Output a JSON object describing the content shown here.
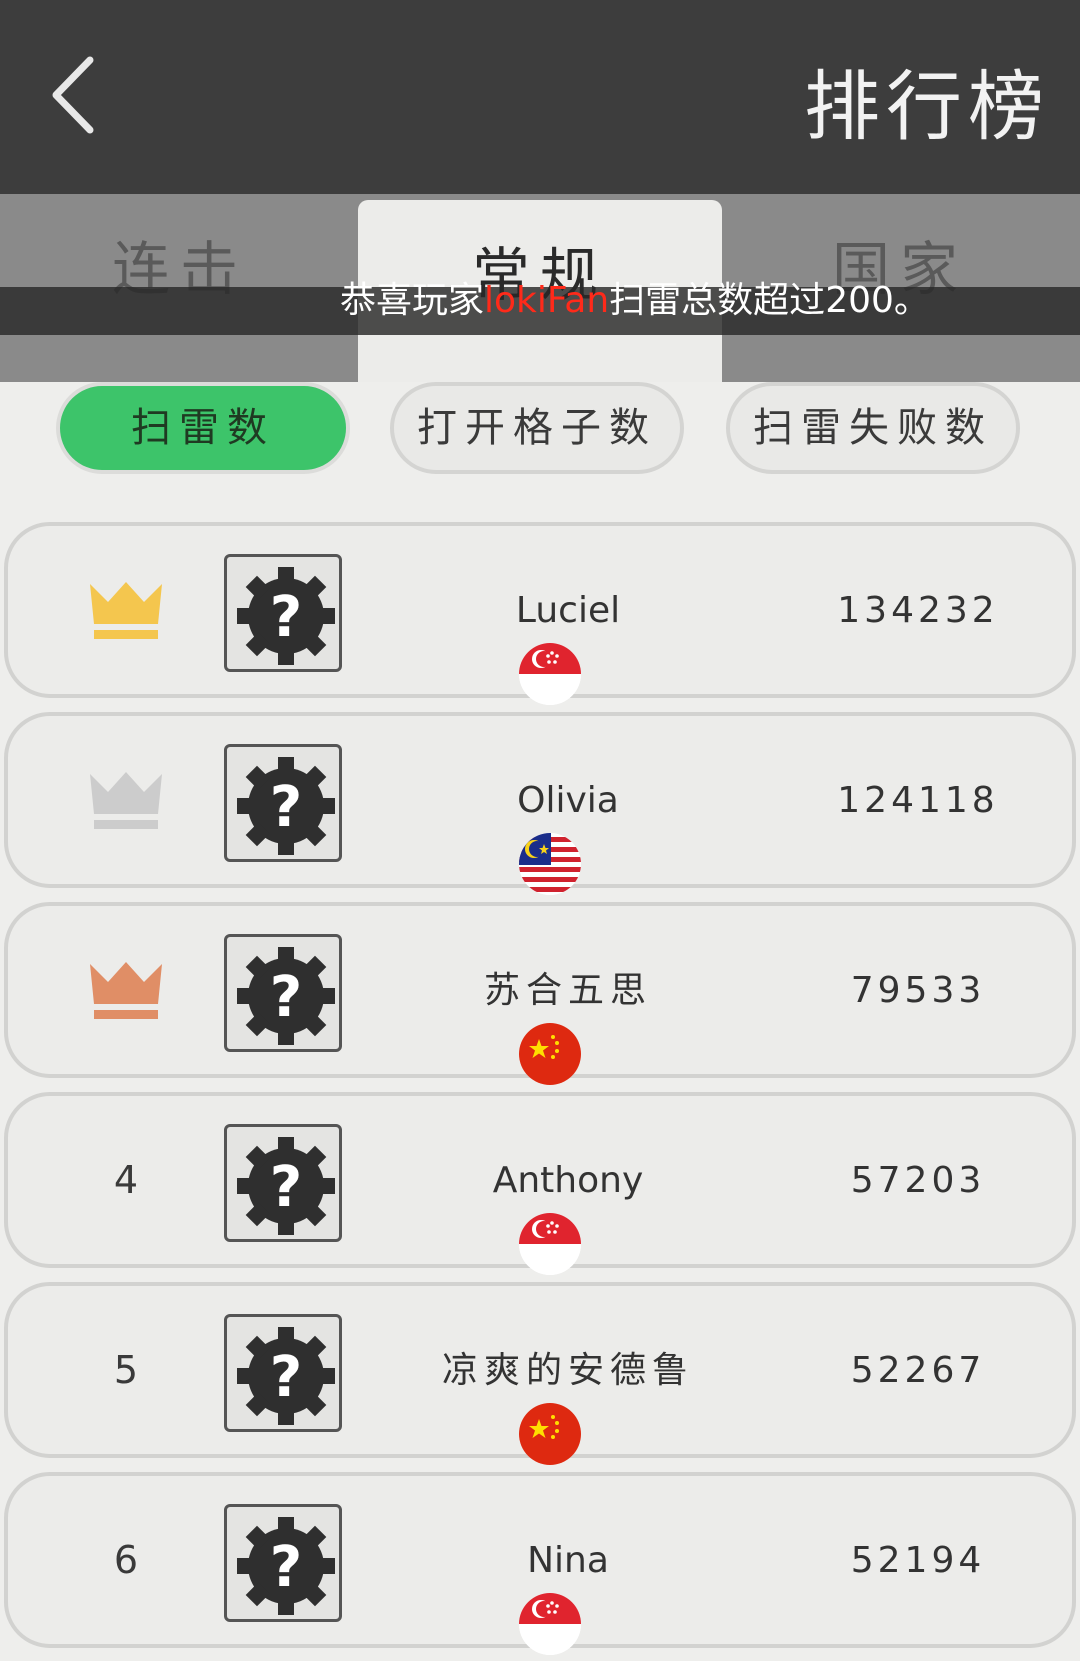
{
  "header": {
    "title": "排行榜",
    "back_icon": "chevron-left-icon"
  },
  "tabs": [
    {
      "label": "连击",
      "active": false
    },
    {
      "label": "常规",
      "active": true
    },
    {
      "label": "国家",
      "active": false
    }
  ],
  "marquee": {
    "prefix": "恭喜玩家",
    "player": "lokiFan",
    "middle": "扫雷总数超过",
    "number": "200",
    "suffix": "。"
  },
  "filters": [
    {
      "label": "扫雷数",
      "active": true
    },
    {
      "label": "打开格子数",
      "active": false
    },
    {
      "label": "扫雷失败数",
      "active": false
    }
  ],
  "colors": {
    "active_filter": "#3dc46a",
    "gold": "#f4c64e",
    "silver": "#cccccc",
    "bronze": "#e08e66",
    "highlight": "#ff2a1a"
  },
  "leaderboard": [
    {
      "rank": "1",
      "rank_icon": "gold-crown-icon",
      "name": "Luciel",
      "score": "134232",
      "flag": "singapore-flag-icon"
    },
    {
      "rank": "2",
      "rank_icon": "silver-crown-icon",
      "name": "Olivia",
      "score": "124118",
      "flag": "malaysia-flag-icon"
    },
    {
      "rank": "3",
      "rank_icon": "bronze-crown-icon",
      "name": "苏合五思",
      "score": "79533",
      "flag": "china-flag-icon"
    },
    {
      "rank": "4",
      "name": "Anthony",
      "score": "57203",
      "flag": "singapore-flag-icon"
    },
    {
      "rank": "5",
      "name": "凉爽的安德鲁",
      "score": "52267",
      "flag": "china-flag-icon"
    },
    {
      "rank": "6",
      "name": "Nina",
      "score": "52194",
      "flag": "singapore-flag-icon"
    }
  ]
}
